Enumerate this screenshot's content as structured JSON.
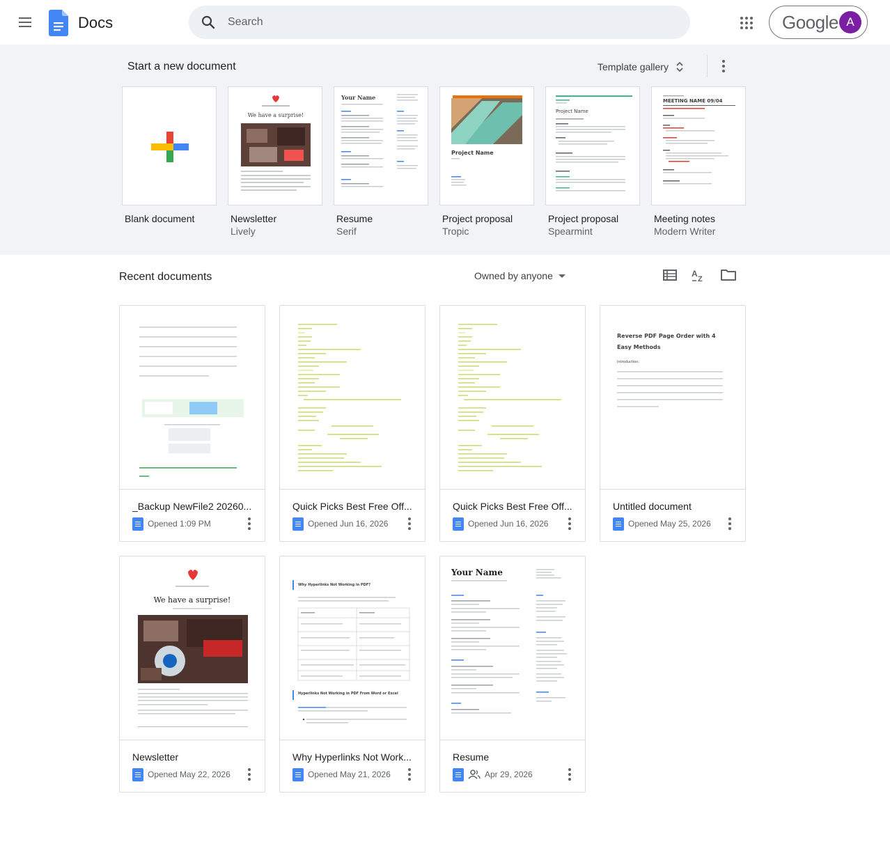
{
  "header": {
    "app_name": "Docs",
    "search_placeholder": "Search",
    "account_brand": "Google",
    "avatar_initial": "A"
  },
  "templates": {
    "title": "Start a new document",
    "gallery_label": "Template gallery",
    "items": [
      {
        "name": "Blank document",
        "sub": ""
      },
      {
        "name": "Newsletter",
        "sub": "Lively"
      },
      {
        "name": "Resume",
        "sub": "Serif"
      },
      {
        "name": "Project proposal",
        "sub": "Tropic"
      },
      {
        "name": "Project proposal",
        "sub": "Spearmint"
      },
      {
        "name": "Meeting notes",
        "sub": "Modern Writer"
      }
    ],
    "thumbs": {
      "newsletter_heading": "We have a surprise!",
      "resume_name": "Your Name",
      "tropic_title": "Project Name",
      "spearmint_title": "Project Name",
      "meeting_title": "MEETING NAME 09/04"
    }
  },
  "recent": {
    "title": "Recent documents",
    "owner_filter": "Owned by anyone",
    "docs": [
      {
        "title": "_Backup NewFile2 20260...",
        "meta": "Opened 1:09 PM",
        "shared": false
      },
      {
        "title": "Quick Picks Best Free Off...",
        "meta": "Opened Jun 16, 2026",
        "shared": false
      },
      {
        "title": "Quick Picks Best Free Off...",
        "meta": "Opened Jun 16, 2026",
        "shared": false
      },
      {
        "title": "Untitled document",
        "meta": "Opened May 25, 2026",
        "shared": false
      },
      {
        "title": "Newsletter",
        "meta": "Opened May 22, 2026",
        "shared": false
      },
      {
        "title": "Why Hyperlinks Not Work...",
        "meta": "Opened May 21, 2026",
        "shared": false
      },
      {
        "title": "Resume",
        "meta": "Apr 29, 2026",
        "shared": true
      }
    ],
    "thumbs": {
      "untitled_heading": "Reverse PDF Page Order with 4 Easy Methods",
      "untitled_intro": "Introduction:",
      "newsletter_heading": "We have a surprise!",
      "hyperlinks_heading": "Why Hyperlinks Not Working in PDF?",
      "hyperlinks_sub": "Hyperlinks Not Working in PDF From Word or Excel",
      "resume_name": "Your Name"
    }
  },
  "colors": {
    "docs_blue": "#4285f4",
    "avatar": "#7b1fa2",
    "template_bg": "#f1f3f4"
  }
}
